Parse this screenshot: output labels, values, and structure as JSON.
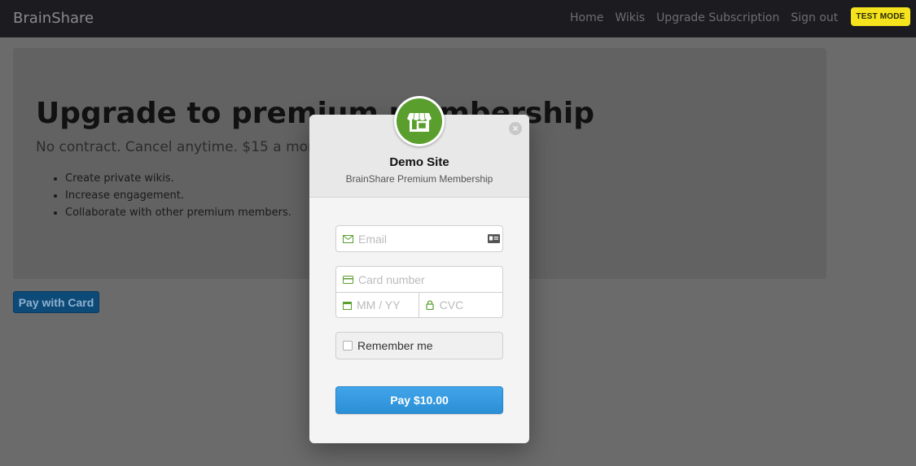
{
  "navbar": {
    "brand": "BrainShare",
    "links": [
      "Home",
      "Wikis",
      "Upgrade Subscription",
      "Sign out"
    ],
    "test_mode_badge": "TEST MODE"
  },
  "jumbotron": {
    "title": "Upgrade to premium membership",
    "lead": "No contract. Cancel anytime. $15 a month.",
    "features": [
      "Create private wikis.",
      "Increase engagement.",
      "Collaborate with other premium members."
    ]
  },
  "pay_with_card_label": "Pay with Card",
  "checkout": {
    "merchant_name": "Demo Site",
    "description": "BrainShare Premium Membership",
    "email_placeholder": "Email",
    "card_placeholder": "Card number",
    "expiry_placeholder": "MM / YY",
    "cvc_placeholder": "CVC",
    "remember_label": "Remember me",
    "pay_button_label": "Pay $10.00",
    "close_symbol": "×",
    "logo_icon": "storefront-icon",
    "accent_color": "#5a9e2d",
    "pay_button_color": "#3a9ee4"
  }
}
